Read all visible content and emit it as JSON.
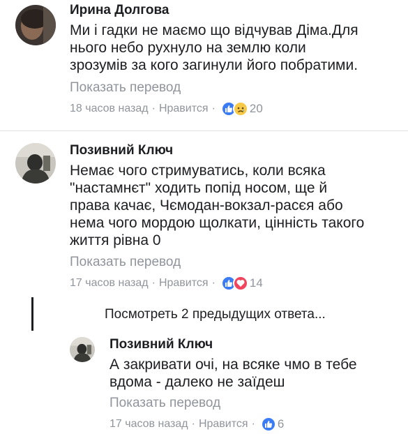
{
  "comments": [
    {
      "author": "Ирина Долгова",
      "lines": [
        "Ми і гадки не маємо що відчував Діма.Для",
        "нього небо рухнуло на землю коли",
        "зрозумів за кого загинули його побратими."
      ],
      "translate": "Показать перевод",
      "time": "18 часов назад",
      "like_label": "Нравится",
      "reaction_icons": [
        "like-icon",
        "sad-icon"
      ],
      "reaction_count": "20"
    },
    {
      "author": "Позивний Ключ",
      "lines": [
        "Немає чого стримуватись, коли всяка",
        "\"настамнєт\" ходить попід носом, ще й",
        "права качає, Чємодан-вокзал-расєя або",
        "нема чого мордою щолкати, цінність такого",
        "життя рівна 0"
      ],
      "translate": "Показать перевод",
      "time": "17 часов назад",
      "like_label": "Нравится",
      "reaction_icons": [
        "like-icon",
        "love-icon"
      ],
      "reaction_count": "14"
    }
  ],
  "previous_replies": "Посмотреть 2 предыдущих ответа...",
  "reply": {
    "author": "Позивний Ключ",
    "lines": [
      "А закривати очі, на всяке чмо в тебе",
      "вдома - далеко не заїдеш"
    ],
    "translate": "Показать перевод",
    "time": "17 часов назад",
    "like_label": "Нравится",
    "reaction_icons": [
      "like-icon"
    ],
    "reaction_count": "6"
  },
  "colors": {
    "like_blue": "#3b7cf5",
    "sad_yellow": "#f7c948",
    "love_red": "#f0455c",
    "meta_gray": "#90949c"
  }
}
